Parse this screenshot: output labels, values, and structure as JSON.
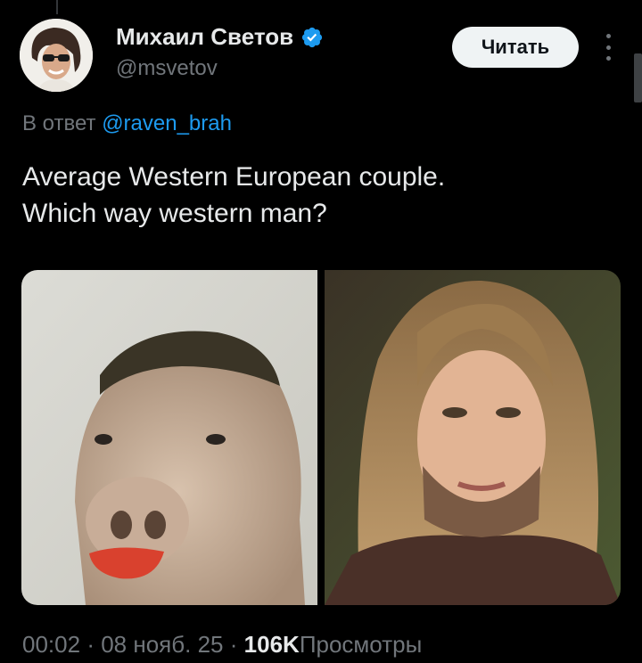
{
  "tweet": {
    "author_name": "Михаил Светов",
    "author_handle": "@msvetov",
    "follow_label": "Читать",
    "reply_prefix": "В ответ",
    "reply_handle": "@raven_brah",
    "text_line1": "Average Western European couple.",
    "text_line2": "Which way western man?",
    "time": "00:02",
    "separator": "·",
    "date": "08 нояб. 25",
    "views_count": "106K",
    "views_label": "Просмотры"
  },
  "colors": {
    "background": "#000000",
    "text_primary": "#e7e9ea",
    "text_secondary": "#71767b",
    "link": "#1d9bf0",
    "verified": "#1d9bf0",
    "follow_button_bg": "#eff3f4"
  },
  "icons": {
    "verified": "verified-badge-icon",
    "more": "more-vertical-icon"
  },
  "media": {
    "images": [
      {
        "subject": "pig-with-haircut-photo"
      },
      {
        "subject": "bearded-person-long-hair-photo"
      }
    ]
  }
}
